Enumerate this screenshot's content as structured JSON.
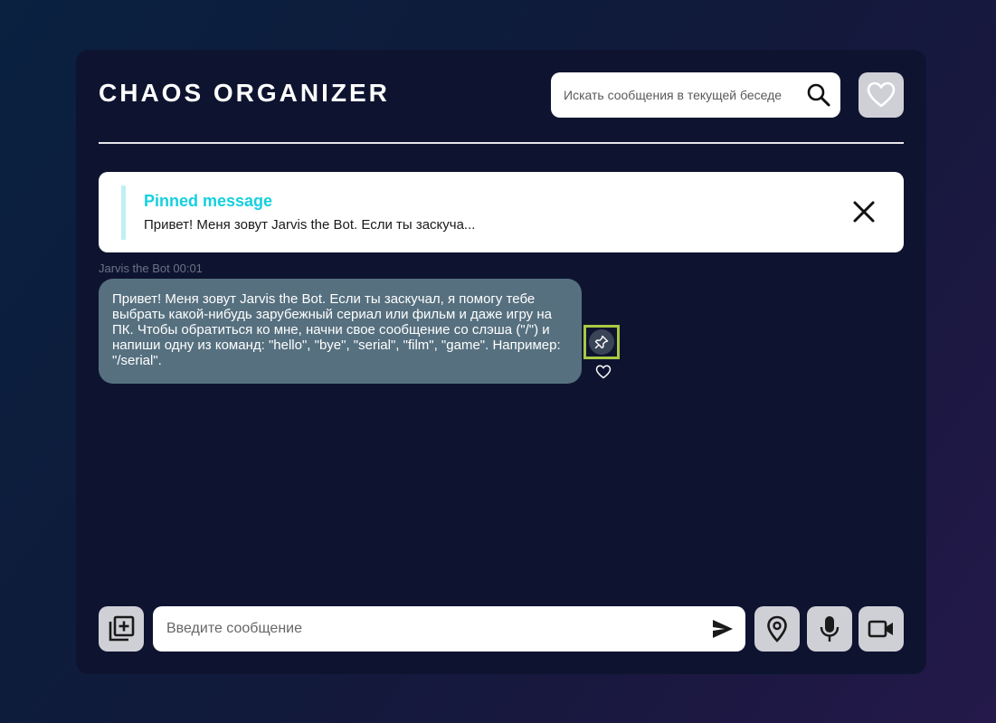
{
  "header": {
    "title": "CHAOS ORGANIZER",
    "search_placeholder": "Искать сообщения в текущей беседе",
    "search_icon": "search-icon",
    "favorites_icon": "heart-icon"
  },
  "pinned": {
    "title": "Pinned message",
    "text": "Привет! Меня зовут Jarvis the Bot. Если ты заскуча...",
    "close_icon": "close-icon"
  },
  "messages": [
    {
      "meta": "Jarvis the Bot 00:01",
      "text": "Привет! Меня зовут Jarvis the Bot. Если ты заскучал, я помогу тебе выбрать какой-нибудь зарубежный сериал или фильм и даже игру на ПК. Чтобы обратиться ко мне, начни свое сообщение со слэша (\"/\") и напиши одну из команд: \"hello\", \"bye\", \"serial\", \"film\", \"game\". Например: \"/serial\".",
      "actions": [
        "pin-icon",
        "heart-outline-icon"
      ]
    }
  ],
  "composer": {
    "placeholder": "Введите сообщение",
    "attach_icon": "add-file-icon",
    "send_icon": "send-icon",
    "geo_icon": "location-icon",
    "mic_icon": "microphone-icon",
    "video_icon": "video-camera-icon"
  },
  "colors": {
    "accent": "#15cfe0",
    "bubble": "#56707f",
    "panel": "#0e1430",
    "button": "#cfcfd6",
    "highlight": "#a8c843"
  }
}
